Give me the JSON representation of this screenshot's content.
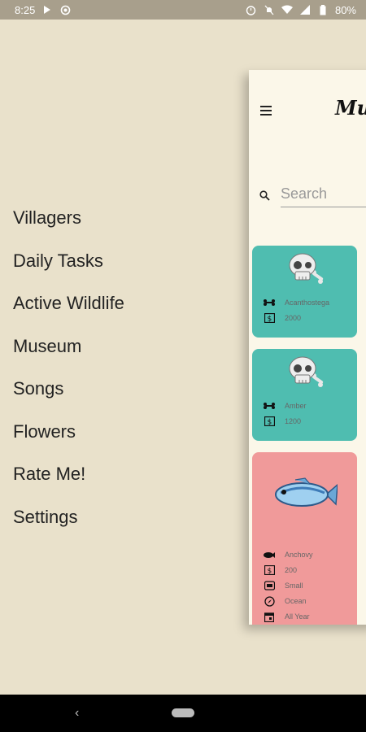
{
  "status": {
    "time": "8:25",
    "battery": "80%"
  },
  "drawer": {
    "items": [
      {
        "label": "Villagers"
      },
      {
        "label": "Daily Tasks"
      },
      {
        "label": "Active Wildlife"
      },
      {
        "label": "Museum"
      },
      {
        "label": "Songs"
      },
      {
        "label": "Flowers"
      },
      {
        "label": "Rate Me!"
      },
      {
        "label": "Settings"
      }
    ]
  },
  "main": {
    "title": "Mus",
    "search_placeholder": "Search",
    "cards": [
      {
        "name": "Acanthostega",
        "price": "2000",
        "icon": "fossil-skull-icon",
        "color": "#4FBDB0"
      },
      {
        "name": "Amber",
        "price": "1200",
        "icon": "fossil-skull-icon",
        "color": "#4FBDB0"
      },
      {
        "name": "Anchovy",
        "price": "200",
        "size": "Small",
        "location": "Ocean",
        "season": "All Year",
        "icon": "fish-icon",
        "color": "#F09A9A"
      }
    ]
  }
}
